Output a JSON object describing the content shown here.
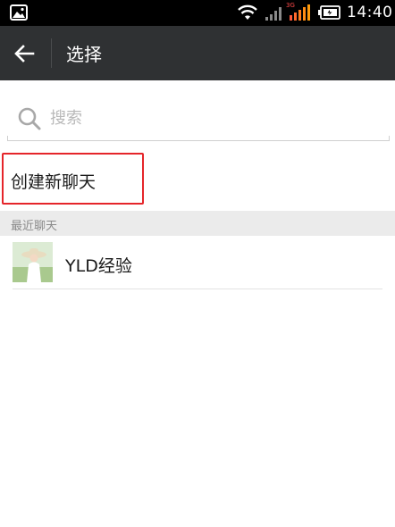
{
  "status_bar": {
    "time": "14:40",
    "network_type": "3G",
    "icons": [
      "gallery-icon",
      "wifi-icon",
      "signal-weak-icon",
      "signal-strong-icon",
      "battery-icon"
    ]
  },
  "action_bar": {
    "back_icon": "arrow-left-icon",
    "title": "选择",
    "background": "#2f3133"
  },
  "search": {
    "placeholder": "搜索",
    "value": ""
  },
  "create_chat": {
    "label": "创建新聊天",
    "highlight_color": "#e5252a"
  },
  "recent_section": {
    "header": "最近聊天",
    "items": [
      {
        "name": "YLD经验",
        "avatar": "avatar-image"
      }
    ]
  }
}
